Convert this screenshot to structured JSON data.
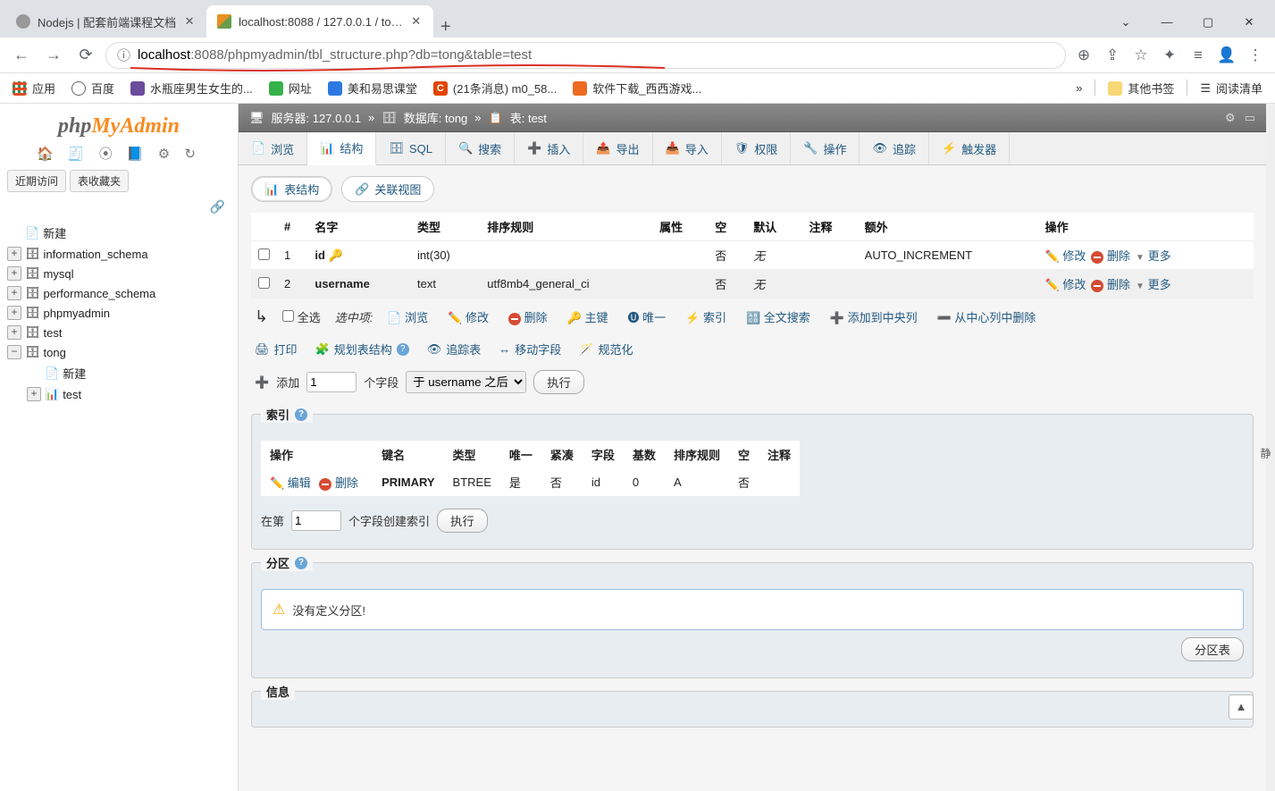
{
  "browser": {
    "tabs": [
      {
        "title": "Nodejs | 配套前端课程文档",
        "active": false
      },
      {
        "title": "localhost:8088 / 127.0.0.1 / to…",
        "active": true
      }
    ],
    "window_buttons": {
      "min": "—",
      "max": "▢",
      "close": "✕",
      "caret": "⌄"
    },
    "nav": {
      "back": "←",
      "forward": "→",
      "reload": "⟳"
    },
    "url_info_icon": "ⓘ",
    "url_plain_prefix": "localhost",
    "url_rest": ":8088/phpmyadmin/tbl_structure.php?db=tong&table=test",
    "addr_icons": {
      "zoom": "⊕",
      "share": "⇪",
      "star": "☆",
      "ext": "✦",
      "reader": "≡",
      "profile": "👤",
      "menu": "⋮"
    }
  },
  "bookmarks": {
    "items": [
      {
        "icon": "grid",
        "label": "应用"
      },
      {
        "icon": "globe",
        "label": "百度"
      },
      {
        "icon": "purple",
        "label": "水瓶座男生女生的..."
      },
      {
        "icon": "green",
        "label": "网址"
      },
      {
        "icon": "blue",
        "label": "美和易思课堂"
      },
      {
        "icon": "cred",
        "label": "(21条消息) m0_58..."
      },
      {
        "icon": "orange",
        "label": "软件下载_西西游戏..."
      }
    ],
    "overflow": "»",
    "right": [
      {
        "icon": "folder",
        "label": "其他书签"
      },
      {
        "icon": "reader",
        "label": "阅读清单"
      }
    ]
  },
  "sidebar": {
    "logo_php": "php",
    "logo_myadmin": "MyAdmin",
    "toolbar_glyphs": "🏠 🧾 ⦿ 📘 ⚙ ↻",
    "recent_tab1": "近期访问",
    "recent_tab2": "表收藏夹",
    "link_glyph": "🔗",
    "tree": {
      "new": "新建",
      "nodes": [
        "information_schema",
        "mysql",
        "performance_schema",
        "phpmyadmin",
        "test"
      ],
      "open_db": "tong",
      "open_new": "新建",
      "open_table": "test"
    }
  },
  "breadcrumb": {
    "server_label": "服务器:",
    "server": "127.0.0.1",
    "db_label": "数据库:",
    "db": "tong",
    "table_label": "表:",
    "table": "test"
  },
  "maintabs": [
    {
      "icon": "📄",
      "label": "浏览"
    },
    {
      "icon": "📊",
      "label": "结构",
      "active": true
    },
    {
      "icon": "🗄",
      "label": "SQL"
    },
    {
      "icon": "🔍",
      "label": "搜索"
    },
    {
      "icon": "➕",
      "label": "插入"
    },
    {
      "icon": "📤",
      "label": "导出"
    },
    {
      "icon": "📥",
      "label": "导入"
    },
    {
      "icon": "🛡",
      "label": "权限"
    },
    {
      "icon": "🔧",
      "label": "操作"
    },
    {
      "icon": "👁",
      "label": "追踪"
    },
    {
      "icon": "⚡",
      "label": "触发器"
    }
  ],
  "subtabs": {
    "structure": "表结构",
    "relation": "关联视图"
  },
  "columns": {
    "headers": [
      "#",
      "名字",
      "类型",
      "排序规则",
      "属性",
      "空",
      "默认",
      "注释",
      "额外",
      "操作"
    ],
    "rows": [
      {
        "n": "1",
        "name": "id",
        "is_pk": true,
        "type": "int(30)",
        "collation": "",
        "null": "否",
        "default": "无",
        "extra": "AUTO_INCREMENT"
      },
      {
        "n": "2",
        "name": "username",
        "is_pk": false,
        "type": "text",
        "collation": "utf8mb4_general_ci",
        "null": "否",
        "default": "无",
        "extra": ""
      }
    ],
    "row_actions": {
      "edit": "修改",
      "delete": "删除",
      "more": "更多"
    }
  },
  "check_row": {
    "arrow": "↳",
    "select_all": "全选",
    "with_selected": "选中项:",
    "actions": [
      "浏览",
      "修改",
      "删除",
      "主键",
      "唯一",
      "索引",
      "全文搜索",
      "添加到中央列",
      "从中心列中删除"
    ]
  },
  "link_row": {
    "print": "打印",
    "analyze": "规划表结构",
    "track": "追踪表",
    "move": "移动字段",
    "normalize": "规范化"
  },
  "add_fields": {
    "icon": "➕",
    "label": "添加",
    "count_value": "1",
    "unit": "个字段",
    "position_option": "于 username 之后",
    "go": "执行"
  },
  "index_box": {
    "legend": "索引",
    "headers": [
      "操作",
      "键名",
      "类型",
      "唯一",
      "紧凑",
      "字段",
      "基数",
      "排序规则",
      "空",
      "注释"
    ],
    "row": {
      "edit": "编辑",
      "delete": "删除",
      "keyname": "PRIMARY",
      "type": "BTREE",
      "unique": "是",
      "packed": "否",
      "field": "id",
      "cardinality": "0",
      "collation": "A",
      "null": "否",
      "comment": ""
    },
    "create_prefix": "在第",
    "create_value": "1",
    "create_suffix": "个字段创建索引",
    "create_go": "执行"
  },
  "partition_box": {
    "legend": "分区",
    "notice": "没有定义分区!",
    "button": "分区表"
  },
  "info_box": {
    "legend": "信息"
  },
  "right_hint": "静"
}
